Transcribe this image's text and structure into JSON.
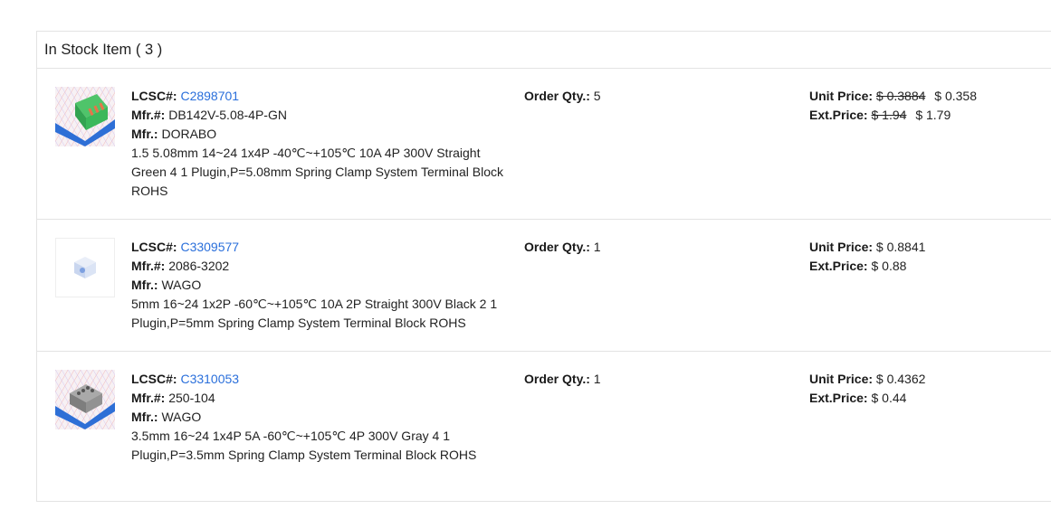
{
  "header": {
    "title": "In Stock Item ( 3 )"
  },
  "labels": {
    "lcsc": "LCSC#:",
    "mfr_num": "Mfr.#:",
    "mfr": "Mfr.:",
    "order_qty": "Order Qty.:",
    "unit_price": "Unit Price:",
    "ext_price": "Ext.Price:"
  },
  "items": [
    {
      "lcsc": "C2898701",
      "mfr_num": "DB142V-5.08-4P-GN",
      "mfr": "DORABO",
      "description": "1.5 5.08mm 14~24 1x4P -40℃~+105℃ 10A 4P 300V Straight Green 4 1 Plugin,P=5.08mm Spring Clamp System Terminal Block ROHS",
      "order_qty": "5",
      "unit_price_old": "$ 0.3884",
      "unit_price": "$ 0.358",
      "ext_price_old": "$ 1.94",
      "ext_price": "$ 1.79",
      "image_icon": "green-terminal-block-icon"
    },
    {
      "lcsc": "C3309577",
      "mfr_num": "2086-3202",
      "mfr": "WAGO",
      "description": "5mm 16~24 1x2P -60℃~+105℃ 10A 2P Straight 300V Black 2 1 Plugin,P=5mm Spring Clamp System Terminal Block ROHS",
      "order_qty": "1",
      "unit_price": "$ 0.8841",
      "ext_price": "$ 0.88",
      "image_icon": "placeholder-box-icon"
    },
    {
      "lcsc": "C3310053",
      "mfr_num": "250-104",
      "mfr": "WAGO",
      "description": "3.5mm 16~24 1x4P 5A -60℃~+105℃ 4P 300V Gray 4 1 Plugin,P=3.5mm Spring Clamp System Terminal Block ROHS",
      "order_qty": "1",
      "unit_price": "$ 0.4362",
      "ext_price": "$ 0.44",
      "image_icon": "gray-terminal-block-icon"
    }
  ],
  "colors": {
    "link": "#2a6fdb",
    "border": "#e3e3e3"
  }
}
